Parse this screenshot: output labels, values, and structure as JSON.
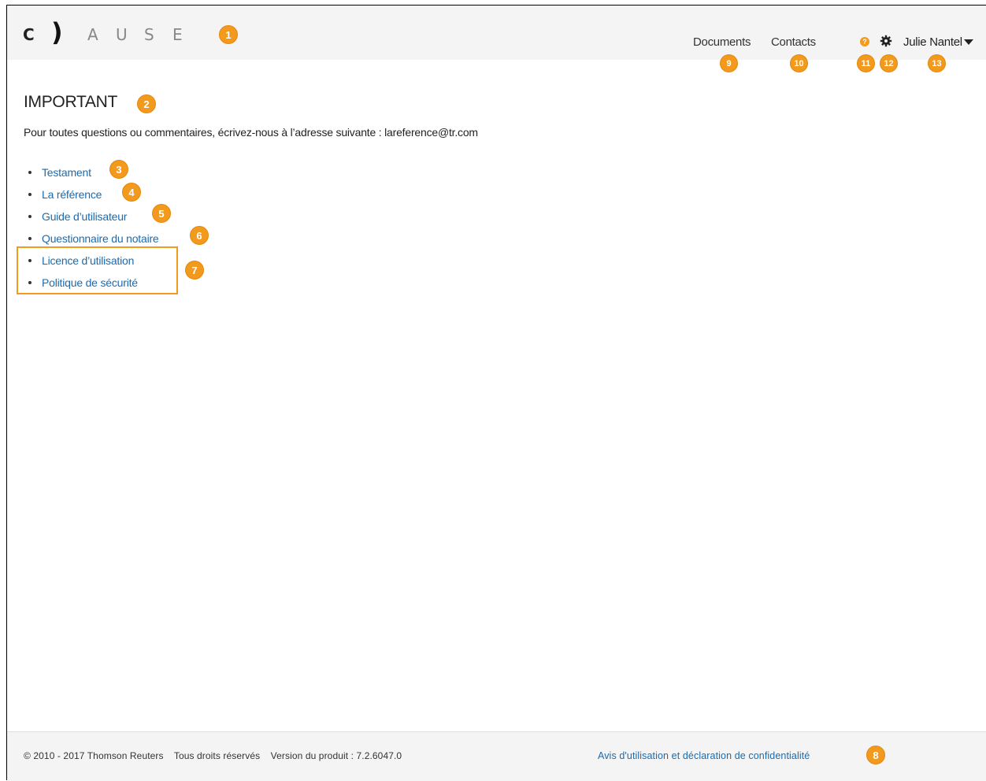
{
  "header": {
    "logo": {
      "letters": [
        "C",
        ")",
        "A",
        "U",
        "S",
        "E"
      ]
    },
    "nav": {
      "documents": "Documents",
      "contacts": "Contacts"
    },
    "help_icon_glyph": "?",
    "user_name": "Julie Nantel"
  },
  "main": {
    "title": "IMPORTANT",
    "intro": "Pour toutes questions ou commentaires, écrivez-nous à l’adresse suivante : lareference@tr.com",
    "links": [
      "Testament",
      "La référence",
      "Guide d’utilisateur",
      "Questionnaire du notaire",
      "Licence d’utilisation",
      "Politique de sécurité"
    ]
  },
  "footer": {
    "copyright": "© 2010 - 2017 Thomson Reuters",
    "rights": "Tous droits réservés",
    "version": "Version du produit : 7.2.6047.0",
    "legal_link": "Avis d'utilisation et déclaration de confidentialité"
  },
  "annotations": [
    "1",
    "2",
    "3",
    "4",
    "5",
    "6",
    "7",
    "8",
    "9",
    "10",
    "11",
    "12",
    "13"
  ],
  "colors": {
    "accent": "#f19a1e",
    "link": "#1a6bb0"
  }
}
